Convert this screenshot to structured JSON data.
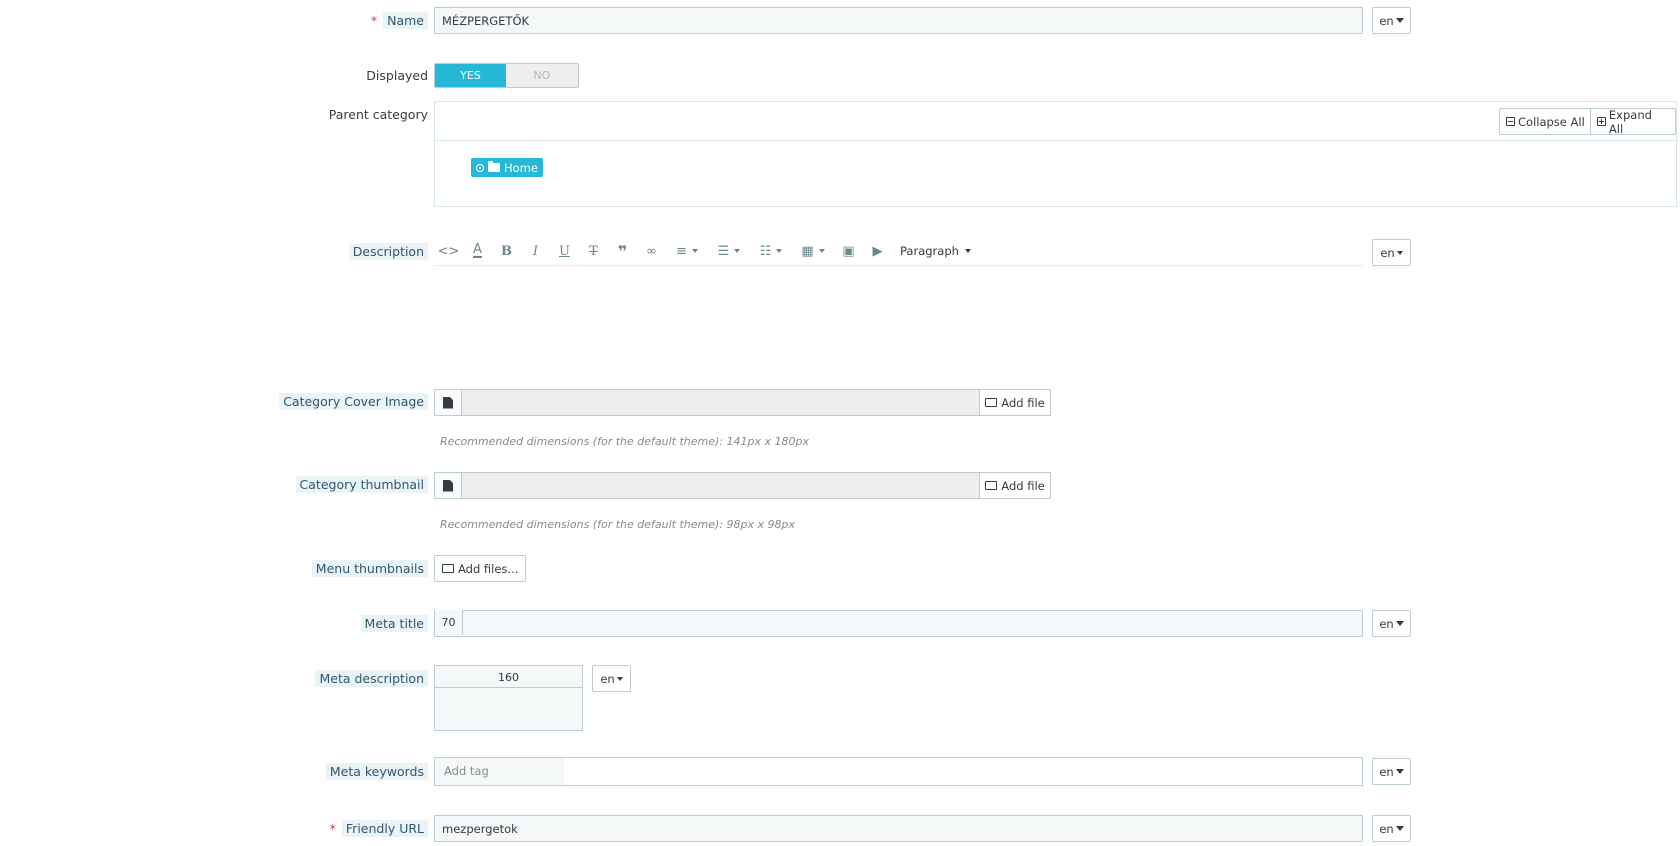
{
  "name": {
    "label": "Name",
    "required_mark": "*",
    "value": "MÉZPERGETŐK",
    "lang": "en"
  },
  "displayed": {
    "label": "Displayed",
    "yes": "YES",
    "no": "NO",
    "selected": "YES"
  },
  "parent_category": {
    "label": "Parent category",
    "collapse_all": "Collapse All",
    "expand_all": "Expand All",
    "selected": "Home"
  },
  "description": {
    "label": "Description",
    "lang": "en",
    "format": "Paragraph",
    "toolbar_icons": [
      "code-icon",
      "text-color-icon",
      "bold-icon",
      "italic-icon",
      "underline-icon",
      "strikethrough-icon",
      "quote-icon",
      "link-icon",
      "align-icon",
      "bullet-list-icon",
      "numbered-list-icon",
      "table-icon",
      "image-icon",
      "media-icon"
    ]
  },
  "cover_image": {
    "label": "Category Cover Image",
    "button": "Add file",
    "help": "Recommended dimensions (for the default theme): 141px x 180px"
  },
  "thumbnail": {
    "label": "Category thumbnail",
    "button": "Add file",
    "help": "Recommended dimensions (for the default theme): 98px x 98px"
  },
  "menu_thumbnails": {
    "label": "Menu thumbnails",
    "button": "Add files..."
  },
  "meta_title": {
    "label": "Meta title",
    "counter": "70",
    "value": "",
    "lang": "en"
  },
  "meta_description": {
    "label": "Meta description",
    "counter": "160",
    "value": "",
    "lang": "en"
  },
  "meta_keywords": {
    "label": "Meta keywords",
    "placeholder": "Add tag",
    "lang": "en"
  },
  "friendly_url": {
    "label": "Friendly URL",
    "required_mark": "*",
    "value": "mezpergetok",
    "lang": "en"
  },
  "colors": {
    "accent": "#25b9d7",
    "border": "#bbcdd2",
    "input_bg": "#f5f8f9",
    "hint_bg": "#eaf3f8",
    "required": "#e0303a"
  }
}
